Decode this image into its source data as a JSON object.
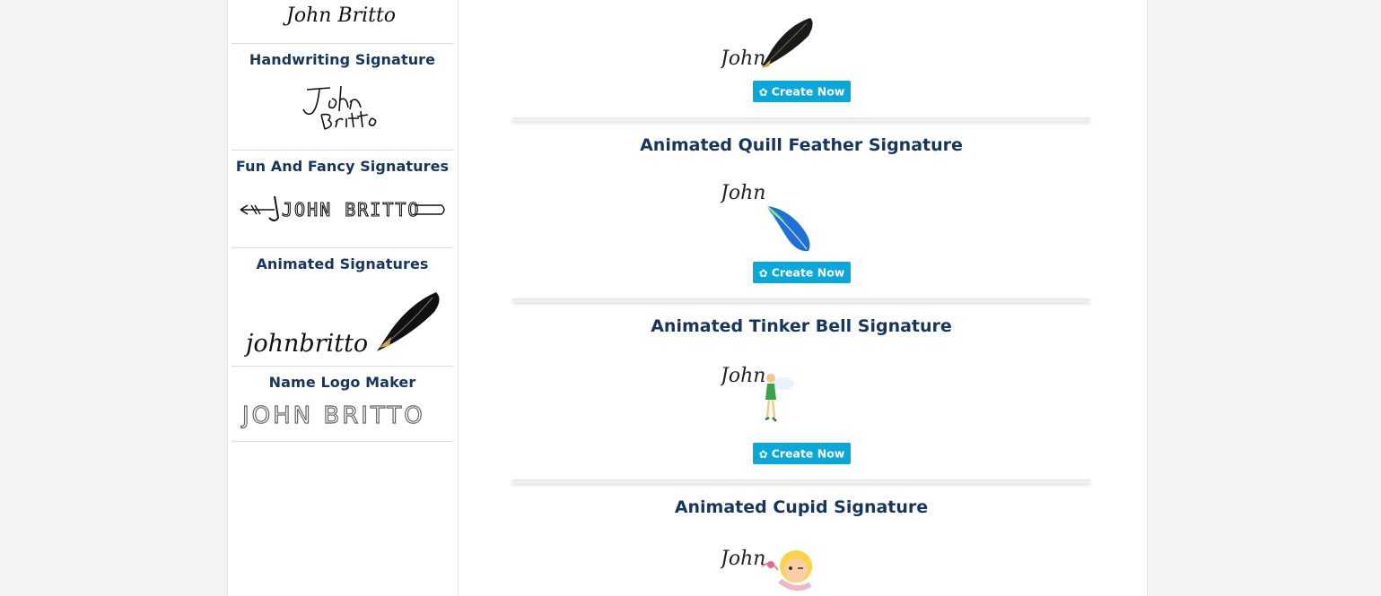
{
  "sidebar": {
    "top_signature_text": "John Britto",
    "items": [
      {
        "title": "Handwriting Signature",
        "preview": "John Britto"
      },
      {
        "title": "Fun And Fancy Signatures",
        "preview": "JOHN BRITTO"
      },
      {
        "title": "Animated Signatures",
        "preview": "johnbritto"
      },
      {
        "title": "Name Logo Maker",
        "preview": "JOHN BRITTO"
      }
    ]
  },
  "main": {
    "preview_name": "John",
    "create_label": "Create Now",
    "cards": [
      {
        "title": ""
      },
      {
        "title": "Animated Quill Feather Signature"
      },
      {
        "title": "Animated Tinker Bell Signature"
      },
      {
        "title": "Animated Cupid Signature"
      }
    ]
  },
  "colors": {
    "title": "#17365d",
    "button": "#0aa8d8"
  }
}
